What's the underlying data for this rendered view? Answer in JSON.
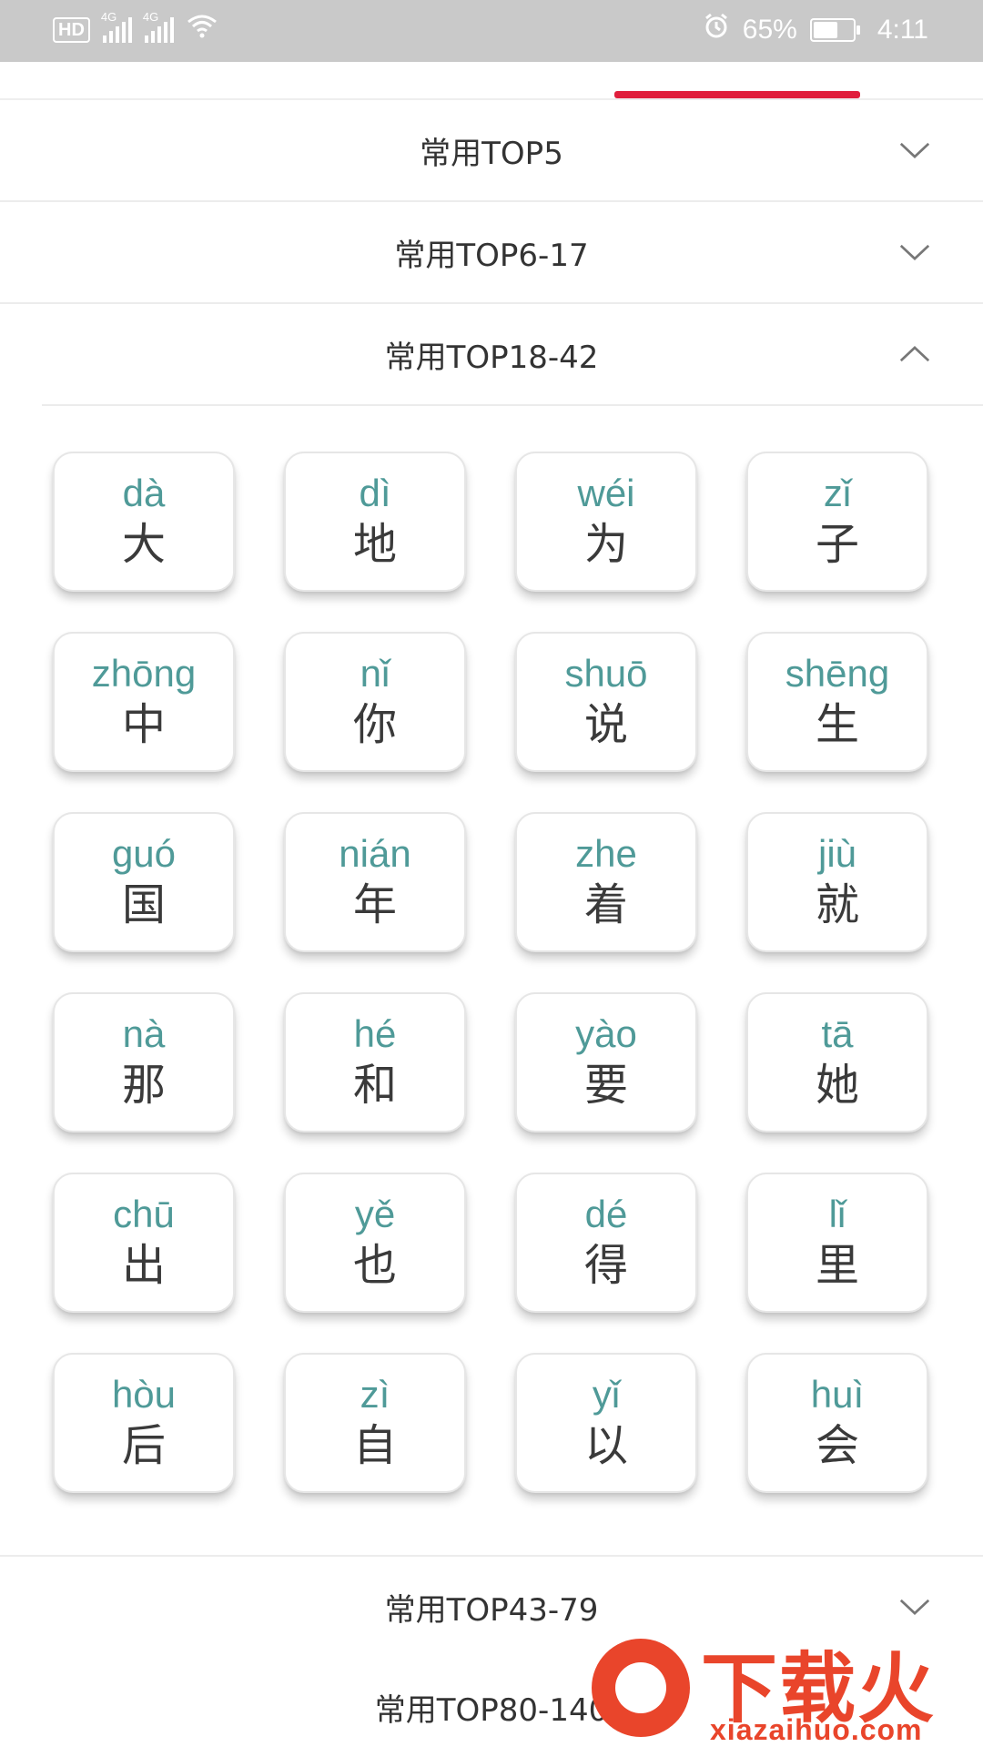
{
  "status_bar": {
    "left_badges": [
      "HD",
      "4G",
      "4G"
    ],
    "battery_percent": "65%",
    "battery_level": 0.65,
    "time": "4:11",
    "icons": [
      "hd-icon",
      "signal-icon",
      "signal-icon",
      "wifi-icon",
      "alarm-icon",
      "battery-icon"
    ]
  },
  "tabs": {
    "active_indicator_color": "#e01e3c"
  },
  "sections": [
    {
      "title": "常用TOP5",
      "expanded": false
    },
    {
      "title": "常用TOP6-17",
      "expanded": false
    },
    {
      "title": "常用TOP18-42",
      "expanded": true
    },
    {
      "title": "常用TOP43-79",
      "expanded": false
    },
    {
      "title": "常用TOP80-140",
      "expanded": false
    }
  ],
  "cards": [
    {
      "pinyin": "dà",
      "hanzi": "大"
    },
    {
      "pinyin": "dì",
      "hanzi": "地"
    },
    {
      "pinyin": "wéi",
      "hanzi": "为"
    },
    {
      "pinyin": "zǐ",
      "hanzi": "子"
    },
    {
      "pinyin": "zhōng",
      "hanzi": "中"
    },
    {
      "pinyin": "nǐ",
      "hanzi": "你"
    },
    {
      "pinyin": "shuō",
      "hanzi": "说"
    },
    {
      "pinyin": "shēng",
      "hanzi": "生"
    },
    {
      "pinyin": "guó",
      "hanzi": "国"
    },
    {
      "pinyin": "nián",
      "hanzi": "年"
    },
    {
      "pinyin": "zhe",
      "hanzi": "着"
    },
    {
      "pinyin": "jiù",
      "hanzi": "就"
    },
    {
      "pinyin": "nà",
      "hanzi": "那"
    },
    {
      "pinyin": "hé",
      "hanzi": "和"
    },
    {
      "pinyin": "yào",
      "hanzi": "要"
    },
    {
      "pinyin": "tā",
      "hanzi": "她"
    },
    {
      "pinyin": "chū",
      "hanzi": "出"
    },
    {
      "pinyin": "yě",
      "hanzi": "也"
    },
    {
      "pinyin": "dé",
      "hanzi": "得"
    },
    {
      "pinyin": "lǐ",
      "hanzi": "里"
    },
    {
      "pinyin": "hòu",
      "hanzi": "后"
    },
    {
      "pinyin": "zì",
      "hanzi": "自"
    },
    {
      "pinyin": "yǐ",
      "hanzi": "以"
    },
    {
      "pinyin": "huì",
      "hanzi": "会"
    }
  ],
  "colors": {
    "pinyin": "#4f9a98",
    "hanzi": "#3a3a3a",
    "accent": "#e01e3c"
  },
  "watermark": {
    "text": "下载火",
    "url": "xiazaihuo.com"
  }
}
